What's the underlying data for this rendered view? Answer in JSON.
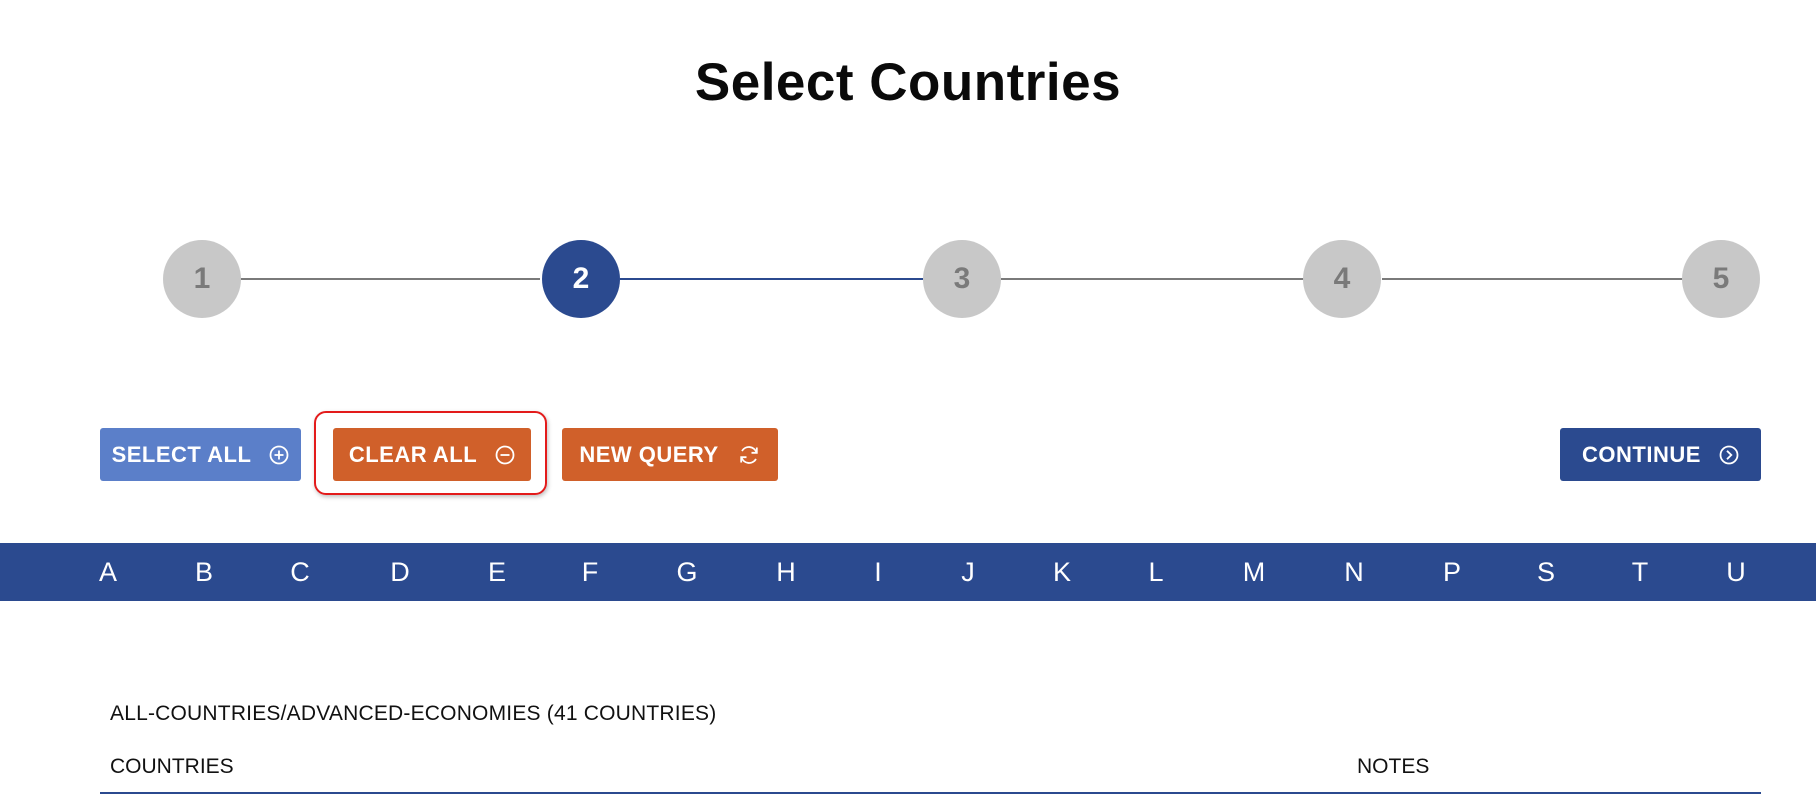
{
  "page": {
    "title": "Select Countries"
  },
  "stepper": {
    "current_step": 2,
    "steps": [
      {
        "label": "1"
      },
      {
        "label": "2"
      },
      {
        "label": "3"
      },
      {
        "label": "4"
      },
      {
        "label": "5"
      }
    ]
  },
  "toolbar": {
    "select_all_label": "SELECT ALL",
    "select_all_icon": "plus-circle-icon",
    "clear_all_label": "CLEAR ALL",
    "clear_all_icon": "minus-circle-icon",
    "new_query_label": "NEW QUERY",
    "new_query_icon": "refresh-icon",
    "continue_label": "CONTINUE",
    "continue_icon": "chevron-right-circle-icon"
  },
  "alphabet": {
    "letters": [
      "A",
      "B",
      "C",
      "D",
      "E",
      "F",
      "G",
      "H",
      "I",
      "J",
      "K",
      "L",
      "M",
      "N",
      "P",
      "S",
      "T",
      "U"
    ]
  },
  "section": {
    "title": "ALL-COUNTRIES/ADVANCED-ECONOMIES (41 COUNTRIES)",
    "columns": {
      "countries": "COUNTRIES",
      "notes": "NOTES"
    }
  },
  "colors": {
    "primary": "#2b4a8f",
    "select_all": "#5b7fc9",
    "action_orange": "#d0602a",
    "step_inactive": "#c8c8c8",
    "highlight": "#e31b1b"
  }
}
